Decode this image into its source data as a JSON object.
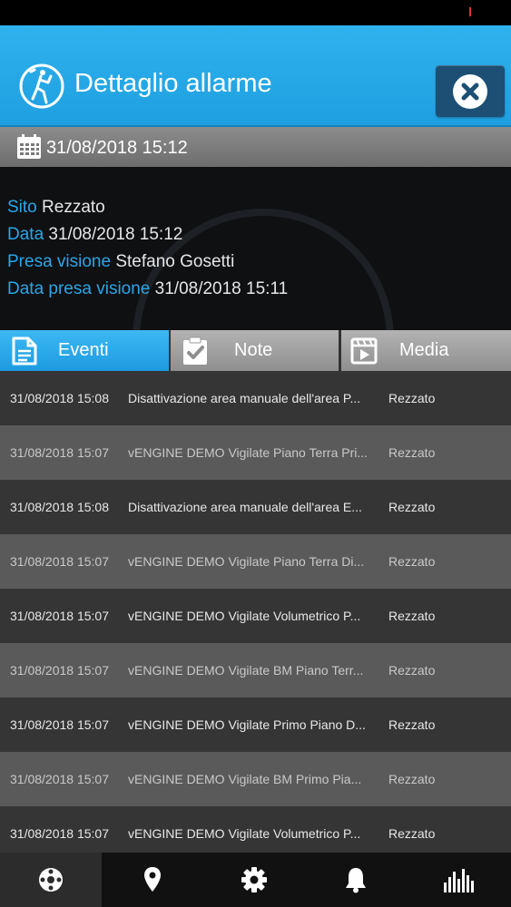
{
  "header": {
    "title": "Dettaglio allarme"
  },
  "date_bar": {
    "datetime": "31/08/2018 15:12"
  },
  "details": [
    {
      "label": "Sito",
      "value": "Rezzato"
    },
    {
      "label": "Data",
      "value": "31/08/2018 15:12"
    },
    {
      "label": "Presa visione",
      "value": "Stefano Gosetti"
    },
    {
      "label": "Data presa visione",
      "value": "31/08/2018 15:11"
    }
  ],
  "tabs": [
    {
      "label": "Eventi",
      "icon": "document-icon",
      "active": true
    },
    {
      "label": "Note",
      "icon": "clipboard-check-icon",
      "active": false
    },
    {
      "label": "Media",
      "icon": "film-icon",
      "active": false
    }
  ],
  "events": [
    {
      "time": "31/08/2018 15:08",
      "description": "Disattivazione area manuale dell'area P...",
      "site": "Rezzato"
    },
    {
      "time": "31/08/2018 15:07",
      "description": "vENGINE DEMO Vigilate Piano Terra Pri...",
      "site": "Rezzato"
    },
    {
      "time": "31/08/2018 15:08",
      "description": "Disattivazione area manuale dell'area E...",
      "site": "Rezzato"
    },
    {
      "time": "31/08/2018 15:07",
      "description": "vENGINE DEMO Vigilate Piano Terra Di...",
      "site": "Rezzato"
    },
    {
      "time": "31/08/2018 15:07",
      "description": "vENGINE DEMO Vigilate Volumetrico P...",
      "site": "Rezzato"
    },
    {
      "time": "31/08/2018 15:07",
      "description": "vENGINE DEMO Vigilate BM Piano Terr...",
      "site": "Rezzato"
    },
    {
      "time": "31/08/2018 15:07",
      "description": "vENGINE DEMO Vigilate Primo Piano D...",
      "site": "Rezzato"
    },
    {
      "time": "31/08/2018 15:07",
      "description": "vENGINE DEMO Vigilate BM Primo Pia...",
      "site": "Rezzato"
    },
    {
      "time": "31/08/2018 15:07",
      "description": "vENGINE DEMO Vigilate Volumetrico P...",
      "site": "Rezzato"
    }
  ],
  "bottom_nav": [
    {
      "icon": "dashboard-icon",
      "active": true
    },
    {
      "icon": "location-pin-icon",
      "active": false
    },
    {
      "icon": "gear-icon",
      "active": false
    },
    {
      "icon": "bell-icon",
      "active": false
    },
    {
      "icon": "equalizer-icon",
      "active": false
    }
  ],
  "colors": {
    "header_blue": "#2fb2ee",
    "label_blue": "#2aa6e8",
    "close_button": "#1c4f73",
    "row_dark": "#353535",
    "row_light": "#5a5a5a"
  }
}
